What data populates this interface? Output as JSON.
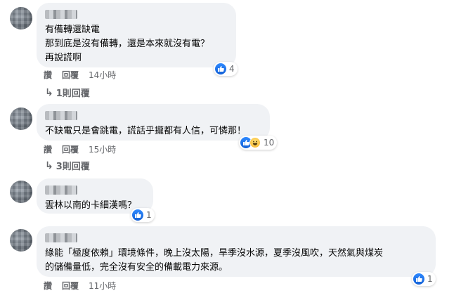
{
  "comments": [
    {
      "text": "有備轉還缺電\n那到底是沒有備轉，還是本來就沒有電？\n再說謊啊",
      "reactions": {
        "count": "4",
        "icons": [
          "like-icon"
        ]
      },
      "actions": {
        "like": "讚",
        "reply": "回覆",
        "time": "14小時"
      },
      "replies_label": "1則回覆"
    },
    {
      "text": "不缺電只是會跳電，謊話乎攏都有人信，可憐那！",
      "reactions": {
        "count": "10",
        "icons": [
          "like-icon",
          "haha-icon"
        ]
      },
      "actions": {
        "like": "讚",
        "reply": "回覆",
        "time": "15小時"
      },
      "replies_label": "3則回覆"
    },
    {
      "text": "雲林以南的卡細漢嗎？",
      "reactions": {
        "count": "1",
        "icons": [
          "like-icon"
        ]
      },
      "actions": {
        "like": "讚",
        "reply": "回覆",
        "time": ""
      }
    },
    {
      "text": "綠能「極度依賴」環境條件，晚上沒太陽，旱季沒水源，夏季沒風吹，天然氣與煤炭\n的儲備量低，完全沒有安全的備載電力來源。",
      "reactions": {
        "count": "1",
        "icons": [
          "like-icon"
        ]
      },
      "actions": {
        "like": "讚",
        "reply": "回覆",
        "time": "11小時"
      }
    }
  ],
  "colors": {
    "bubble": "#f0f2f5",
    "like_blue": "#1877f2",
    "meta_gray": "#65676b"
  }
}
